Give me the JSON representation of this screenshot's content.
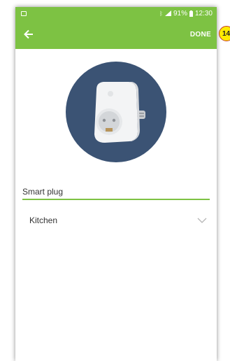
{
  "status_bar": {
    "battery": "91%",
    "time": "12:30",
    "icons": [
      "notification-icon",
      "bluetooth-icon",
      "signal-icon",
      "battery-icon"
    ]
  },
  "app_bar": {
    "back_icon": "back-arrow-icon",
    "done_label": "DONE",
    "color": "#7dc243"
  },
  "device": {
    "image": "smart-plug-image",
    "circle_color": "#3b5374"
  },
  "form": {
    "name_value": "Smart plug",
    "room_selected": "Kitchen"
  },
  "annotation": {
    "step": "14"
  }
}
